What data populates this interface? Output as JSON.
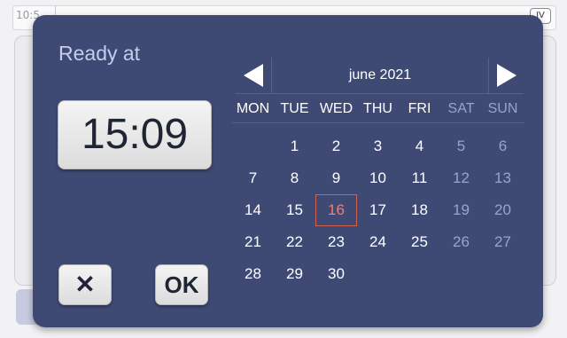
{
  "background": {
    "time_fragment": "10:5",
    "badge": "IV"
  },
  "dialog": {
    "title": "Ready at",
    "time_value": "15:09",
    "cancel_label": "✕",
    "ok_label": "OK"
  },
  "calendar": {
    "month_label": "june 2021",
    "prev_icon": "triangle-left",
    "next_icon": "triangle-right",
    "weekdays": [
      "MON",
      "TUE",
      "WED",
      "THU",
      "FRI",
      "SAT",
      "SUN"
    ],
    "weeks": [
      [
        "",
        "1",
        "2",
        "3",
        "4",
        "5",
        "6"
      ],
      [
        "7",
        "8",
        "9",
        "10",
        "11",
        "12",
        "13"
      ],
      [
        "14",
        "15",
        "16",
        "17",
        "18",
        "19",
        "20"
      ],
      [
        "21",
        "22",
        "23",
        "24",
        "25",
        "26",
        "27"
      ],
      [
        "28",
        "29",
        "30",
        "",
        "",
        "",
        ""
      ]
    ],
    "selected_day": "16",
    "colors": {
      "dialog_bg": "#3f4a74",
      "weekend": "#9aa3c8",
      "selected": "#ff7a62"
    }
  }
}
